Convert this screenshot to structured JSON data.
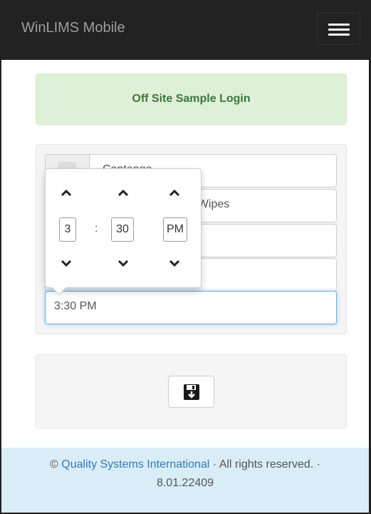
{
  "navbar": {
    "brand": "WinLIMS Mobile",
    "menu_icon": "hamburger-icon"
  },
  "alert": {
    "title": "Off Site Sample Login"
  },
  "form": {
    "field1_value": "Contango",
    "field2_value": "nt Wipes",
    "time_value": "3:30 PM"
  },
  "time_picker": {
    "hour": "3",
    "separator": ":",
    "minute": "30",
    "meridian": "PM"
  },
  "save": {
    "icon": "save-icon"
  },
  "footer": {
    "copyright": "©",
    "company": "Quality Systems International",
    "rights": "· All rights reserved. ·",
    "version": "8.01.22409"
  },
  "colors": {
    "navbar": "#222222",
    "alert_bg": "#dff0d8",
    "alert_text": "#3c763d",
    "footer_bg": "#d9edf7",
    "link": "#337ab7"
  }
}
